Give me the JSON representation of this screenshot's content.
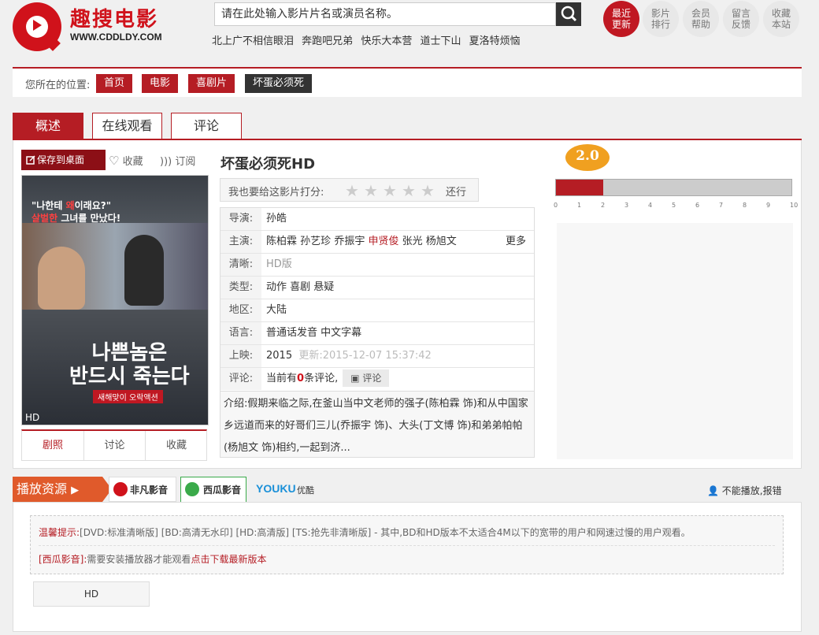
{
  "header": {
    "logo_text": "趣搜电影",
    "logo_url": "WWW.CDDLDY.COM",
    "search_placeholder": "请在此处输入影片片名或演员名称。",
    "hot_links": [
      "北上广不相信眼泪",
      "奔跑吧兄弟",
      "快乐大本营",
      "道士下山",
      "夏洛特烦恼"
    ],
    "nav": [
      {
        "l1": "最近",
        "l2": "更新"
      },
      {
        "l1": "影片",
        "l2": "排行"
      },
      {
        "l1": "会员",
        "l2": "帮助"
      },
      {
        "l1": "留言",
        "l2": "反馈"
      },
      {
        "l1": "收藏",
        "l2": "本站"
      }
    ]
  },
  "breadcrumb": {
    "label": "您所在的位置:",
    "items": [
      "首页",
      "电影",
      "喜剧片",
      "坏蛋必须死"
    ]
  },
  "tabs": [
    "概述",
    "在线观看",
    "评论"
  ],
  "actions": {
    "save": "保存到桌面",
    "fav": "收藏",
    "sub": "订阅"
  },
  "poster": {
    "tag1": "\"나한테",
    "tag_red": "왜",
    "tag2": "이래요?\"",
    "tag3": "살벌한",
    "tag4": "그녀를 만났다!",
    "title1": "나쁜놈은",
    "title2": "반드시 죽는다",
    "sub": "새해맞이 오락액션",
    "badge": "HD"
  },
  "poster_tabs": [
    "剧照",
    "讨论",
    "收藏"
  ],
  "movie": {
    "title": "坏蛋必须死HD",
    "rate_label": "我也要给这影片打分:",
    "rate_back": "还行",
    "rating_stars": 0,
    "rows": [
      {
        "k": "导演:",
        "v": "孙皓"
      },
      {
        "k": "主演:",
        "cast": [
          "陈柏霖",
          "孙艺珍",
          "乔振宇",
          "申贤俊",
          "张光",
          "杨旭文"
        ],
        "more": "更多"
      },
      {
        "k": "清晰:",
        "v": "HD版"
      },
      {
        "k": "类型:",
        "v": "动作 喜剧 悬疑"
      },
      {
        "k": "地区:",
        "v": "大陆"
      },
      {
        "k": "语言:",
        "v": "普通话发音 中文字幕"
      },
      {
        "k": "上映:",
        "v": "2015",
        "updated": "更新:2015-12-07 15:37:42"
      },
      {
        "k": "评论:",
        "pre": "当前有",
        "count": "0",
        "post": "条评论,",
        "btn": "评论"
      }
    ],
    "intro": "介绍:假期来临之际,在釜山当中文老师的强子(陈柏霖 饰)和从中国家乡远道而来的好哥们三儿(乔振宇 饰)、大头(丁文博 饰)和弟弟帕帕(杨旭文 饰)相约,一起到济..."
  },
  "score": {
    "value": "2.0",
    "fraction": 0.2,
    "ticks": [
      "0",
      "1",
      "2",
      "3",
      "4",
      "5",
      "6",
      "7",
      "8",
      "9",
      "10"
    ]
  },
  "source": {
    "title": "播放资源",
    "tabs": [
      "非凡影音",
      "西瓜影音",
      "优酷"
    ],
    "report": "不能播放,报错",
    "tip1_title": "温馨提示:",
    "tip1": "[DVD:标准清晰版] [BD:高清无水印] [HD:高清版] [TS:抢先非清晰版] - 其中,BD和HD版本不太适合4M以下的宽带的用户和网速过慢的用户观看。",
    "tip2_title": "[西瓜影音]:",
    "tip2": "需要安装播放器才能观看",
    "tip2_link": "点击下载最新版本",
    "episode": "HD"
  },
  "colors": {
    "brand": "#b51d24",
    "orange": "#e05a2b",
    "score": "#f0a020"
  }
}
